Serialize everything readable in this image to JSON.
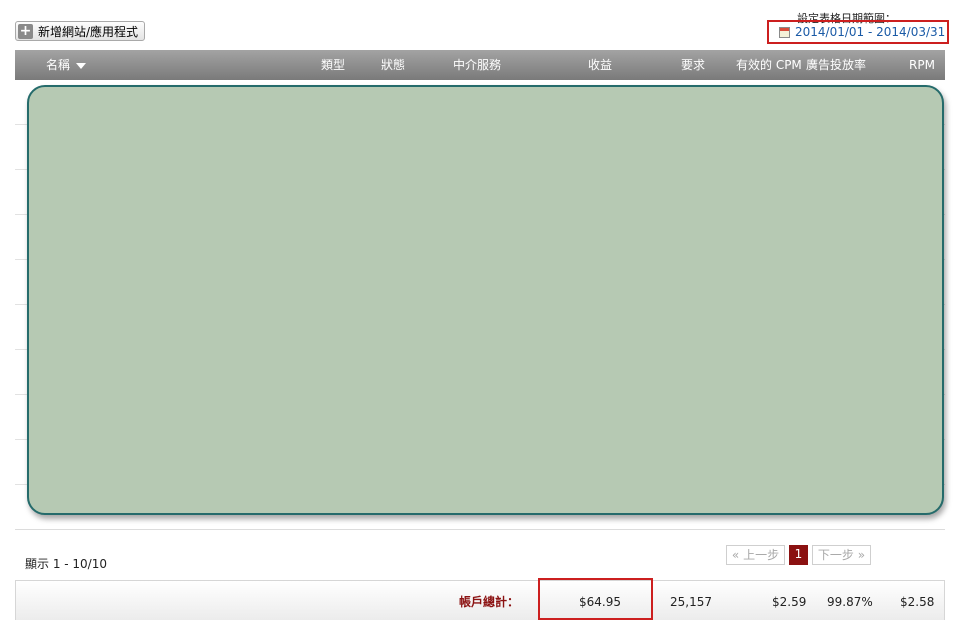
{
  "toolbar": {
    "add_site_label": "新增網站/應用程式"
  },
  "date_range": {
    "caption": "設定表格日期範圍：",
    "value": "2014/01/01 - 2014/03/31"
  },
  "table": {
    "columns": {
      "name": "名稱",
      "type": "類型",
      "status": "狀態",
      "mediation": "中介服務",
      "revenue": "收益",
      "requests": "要求",
      "ecpm": "有效的 CPM",
      "fill_rate": "廣告投放率",
      "rpm": "RPM"
    }
  },
  "footer": {
    "count_label": "顯示 1 - 10/10",
    "pagination": {
      "prev": "« 上一步",
      "current": "1",
      "next": "下一步 »"
    }
  },
  "totals": {
    "title": "帳戶總計：",
    "revenue": "$64.95",
    "requests": "25,157",
    "ecpm": "$2.59",
    "fill_rate": "99.87%",
    "rpm": "$2.58"
  },
  "colors": {
    "accent": "#8b1111",
    "highlight_border": "#cc1f1f",
    "link": "#1a5aa6",
    "overlay_fill": "#b6c9b3",
    "overlay_border": "#256b6b"
  }
}
